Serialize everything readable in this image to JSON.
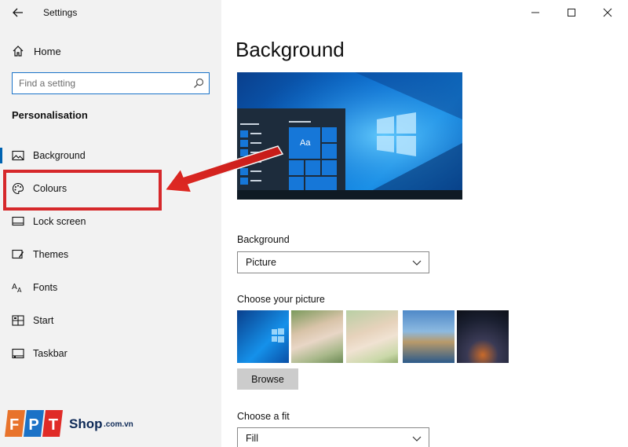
{
  "window": {
    "title": "Settings"
  },
  "sidebar": {
    "home_label": "Home",
    "search_placeholder": "Find a setting",
    "section_heading": "Personalisation",
    "items": [
      {
        "label": "Background",
        "icon": "picture-icon",
        "active": true
      },
      {
        "label": "Colours",
        "icon": "palette-icon",
        "active": false
      },
      {
        "label": "Lock screen",
        "icon": "lock-screen-icon",
        "active": false
      },
      {
        "label": "Themes",
        "icon": "brush-icon",
        "active": false
      },
      {
        "label": "Fonts",
        "icon": "font-icon",
        "active": false
      },
      {
        "label": "Start",
        "icon": "start-grid-icon",
        "active": false
      },
      {
        "label": "Taskbar",
        "icon": "taskbar-icon",
        "active": false
      }
    ]
  },
  "main": {
    "page_title": "Background",
    "preview_tile_text": "Aa",
    "background_label": "Background",
    "background_value": "Picture",
    "choose_picture_label": "Choose your picture",
    "browse_label": "Browse",
    "choose_fit_label": "Choose a fit",
    "fit_value": "Fill"
  },
  "watermark": {
    "brand": "FPT",
    "shop": "Shop",
    "domain": ".com.vn"
  },
  "colors": {
    "accent": "#0063b1",
    "highlight": "#d6282b",
    "sidebar_bg": "#f2f2f2"
  }
}
